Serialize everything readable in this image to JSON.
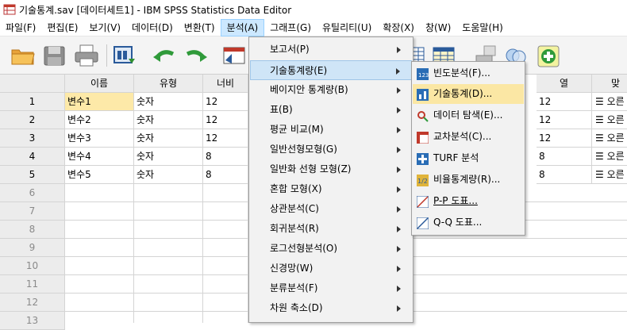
{
  "window": {
    "title": "기술통계.sav [데이터세트1] - IBM SPSS Statistics Data Editor"
  },
  "menubar": [
    {
      "label": "파일(F)"
    },
    {
      "label": "편집(E)"
    },
    {
      "label": "보기(V)"
    },
    {
      "label": "데이터(D)"
    },
    {
      "label": "변환(T)"
    },
    {
      "label": "분석(A)"
    },
    {
      "label": "그래프(G)"
    },
    {
      "label": "유틸리티(U)"
    },
    {
      "label": "확장(X)"
    },
    {
      "label": "창(W)"
    },
    {
      "label": "도움말(H)"
    }
  ],
  "grid": {
    "headers": [
      "이름",
      "유형",
      "너비",
      "열",
      "맞"
    ],
    "rows": [
      {
        "num": "1",
        "name": "변수1",
        "type": "숫자",
        "width": "12",
        "cols": "12",
        "align": "오른"
      },
      {
        "num": "2",
        "name": "변수2",
        "type": "숫자",
        "width": "12",
        "cols": "12",
        "align": "오른"
      },
      {
        "num": "3",
        "name": "변수3",
        "type": "숫자",
        "width": "12",
        "cols": "12",
        "align": "오른"
      },
      {
        "num": "4",
        "name": "변수4",
        "type": "숫자",
        "width": "8",
        "cols": "8",
        "align": "오른"
      },
      {
        "num": "5",
        "name": "변수5",
        "type": "숫자",
        "width": "8",
        "cols": "8",
        "align": "오른"
      }
    ],
    "empty_rows": [
      "6",
      "7",
      "8",
      "9",
      "10",
      "11",
      "12",
      "13"
    ]
  },
  "analyze_menu": [
    {
      "label": "보고서(P)"
    },
    {
      "label": "기술통계량(E)"
    },
    {
      "label": "베이지안 통계량(B)"
    },
    {
      "label": "표(B)"
    },
    {
      "label": "평균 비교(M)"
    },
    {
      "label": "일반선형모형(G)"
    },
    {
      "label": "일반화 선형 모형(Z)"
    },
    {
      "label": "혼합 모형(X)"
    },
    {
      "label": "상관분석(C)"
    },
    {
      "label": "회귀분석(R)"
    },
    {
      "label": "로그선형분석(O)"
    },
    {
      "label": "신경망(W)"
    },
    {
      "label": "분류분석(F)"
    },
    {
      "label": "차원 축소(D)"
    }
  ],
  "descriptive_submenu": [
    {
      "label": "빈도분석(F)...",
      "icon": "frequencies-icon"
    },
    {
      "label": "기술통계(D)...",
      "icon": "descriptives-icon"
    },
    {
      "label": "데이터 탐색(E)...",
      "icon": "explore-icon"
    },
    {
      "label": "교차분석(C)...",
      "icon": "crosstabs-icon"
    },
    {
      "label": "TURF 분석",
      "icon": "turf-icon"
    },
    {
      "label": "비율통계량(R)...",
      "icon": "ratio-icon"
    },
    {
      "label": "P-P 도표...",
      "icon": "pp-plot-icon"
    },
    {
      "label": "Q-Q 도표...",
      "icon": "qq-plot-icon"
    }
  ],
  "colors": {
    "highlight": "#cfe5f7",
    "selected_cell": "#fde9a8",
    "active_menu": "#cce8ff"
  }
}
